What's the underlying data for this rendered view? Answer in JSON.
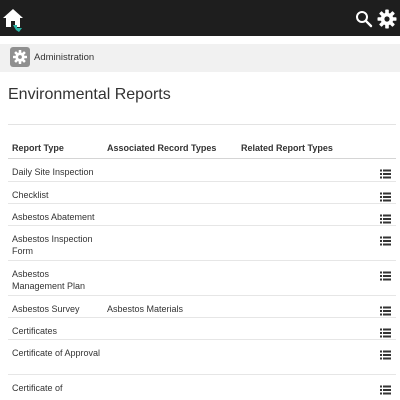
{
  "topbar": {
    "icons": {
      "home": "home-icon",
      "search": "search-icon",
      "settings": "gear-icon"
    },
    "background": "#1e1e1e",
    "accent": "#2fb8a8"
  },
  "breadcrumb": {
    "icon": "gear-icon",
    "label": "Administration"
  },
  "page": {
    "title": "Environmental Reports"
  },
  "table": {
    "columns": [
      "Report Type",
      "Associated Record Types",
      "Related Report Types"
    ],
    "action_icon": "list-icon",
    "rows": [
      {
        "type": "Daily Site Inspection",
        "associated": "",
        "related": ""
      },
      {
        "type": "Checklist",
        "associated": "",
        "related": ""
      },
      {
        "type": "Asbestos Abatement",
        "associated": "",
        "related": ""
      },
      {
        "type": "Asbestos Inspection Form",
        "associated": "",
        "related": ""
      },
      {
        "type": "Asbestos Management Plan",
        "associated": "",
        "related": ""
      },
      {
        "type": "Asbestos Survey",
        "associated": "Asbestos Materials",
        "related": ""
      },
      {
        "type": "Certificates",
        "associated": "",
        "related": ""
      },
      {
        "type": "Certificate of Approval",
        "associated": "",
        "related": ""
      },
      {
        "type": "Certificate of",
        "associated": "",
        "related": ""
      }
    ]
  }
}
